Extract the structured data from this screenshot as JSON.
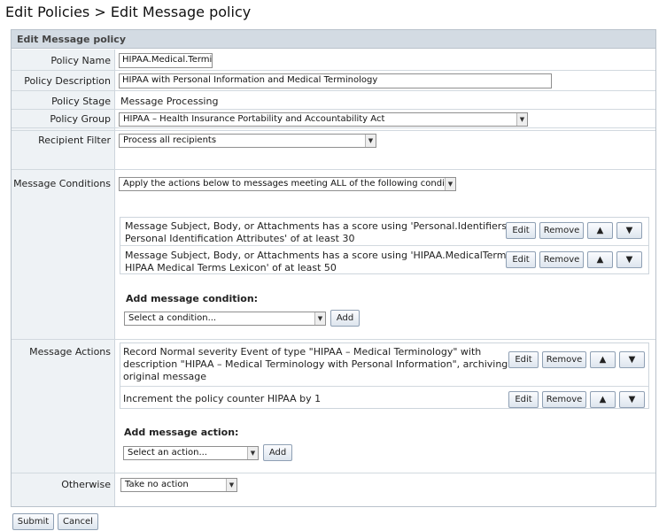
{
  "page_title": "Edit Policies > Edit Message policy",
  "panel_title": "Edit Message policy",
  "fields": {
    "policy_name": {
      "label": "Policy Name",
      "value": "HIPAA.Medical.Termir"
    },
    "policy_description": {
      "label": "Policy Description",
      "value": "HIPAA with Personal Information and Medical Terminology"
    },
    "policy_stage": {
      "label": "Policy Stage",
      "value": "Message Processing"
    },
    "policy_group": {
      "label": "Policy Group",
      "value": "HIPAA – Health Insurance Portability and Accountability Act"
    },
    "recipient_filter": {
      "label": "Recipient Filter",
      "value": "Process all recipients"
    }
  },
  "conditions": {
    "label": "Message Conditions",
    "mode": "Apply the actions below to messages meeting ALL of the following conditions",
    "items": [
      {
        "line1": "Message Subject, Body, or Attachments has a score using 'Personal.Identifiers:",
        "line2": "Personal Identification Attributes' of at least 30"
      },
      {
        "line1": "Message Subject, Body, or Attachments has a score using 'HIPAA.MedicalTerms:",
        "line2": "HIPAA Medical Terms Lexicon' of at least 50"
      }
    ],
    "add_title": "Add message condition:",
    "add_select": "Select a condition...",
    "add_button": "Add"
  },
  "actions": {
    "label": "Message Actions",
    "items": [
      {
        "line1": "Record Normal severity Event of type \"HIPAA – Medical Terminology\" with",
        "line2": "description \"HIPAA – Medical Terminology with Personal Information\", archiving",
        "line3": "original message"
      },
      {
        "line1": "Increment the policy counter HIPAA by 1",
        "line2": "",
        "line3": ""
      }
    ],
    "add_title": "Add message action:",
    "add_select": "Select an action...",
    "add_button": "Add"
  },
  "otherwise": {
    "label": "Otherwise",
    "value": "Take no action"
  },
  "item_buttons": {
    "edit": "Edit",
    "remove": "Remove",
    "up": "▲",
    "down": "▼"
  },
  "footer": {
    "submit": "Submit",
    "cancel": "Cancel"
  }
}
